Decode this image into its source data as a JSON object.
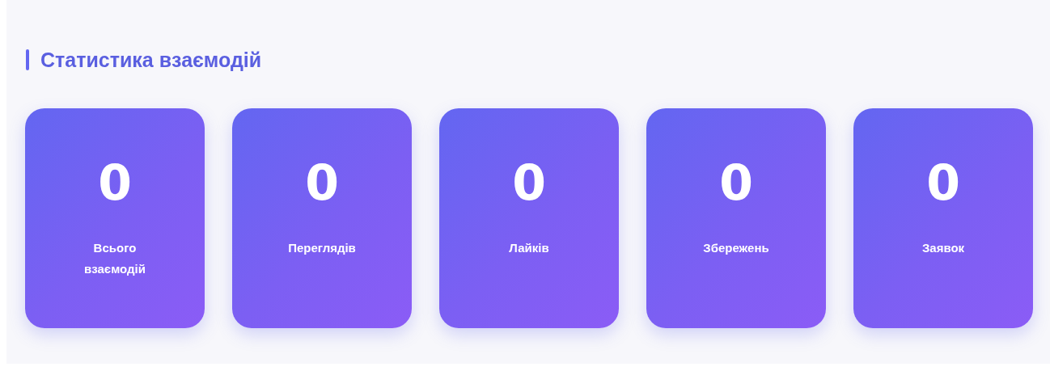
{
  "section": {
    "title": "Статистика взаємодій"
  },
  "stats": [
    {
      "value": "0",
      "label": "Всього взаємодій"
    },
    {
      "value": "0",
      "label": "Переглядів"
    },
    {
      "value": "0",
      "label": "Лайків"
    },
    {
      "value": "0",
      "label": "Збережень"
    },
    {
      "value": "0",
      "label": "Заявок"
    }
  ]
}
